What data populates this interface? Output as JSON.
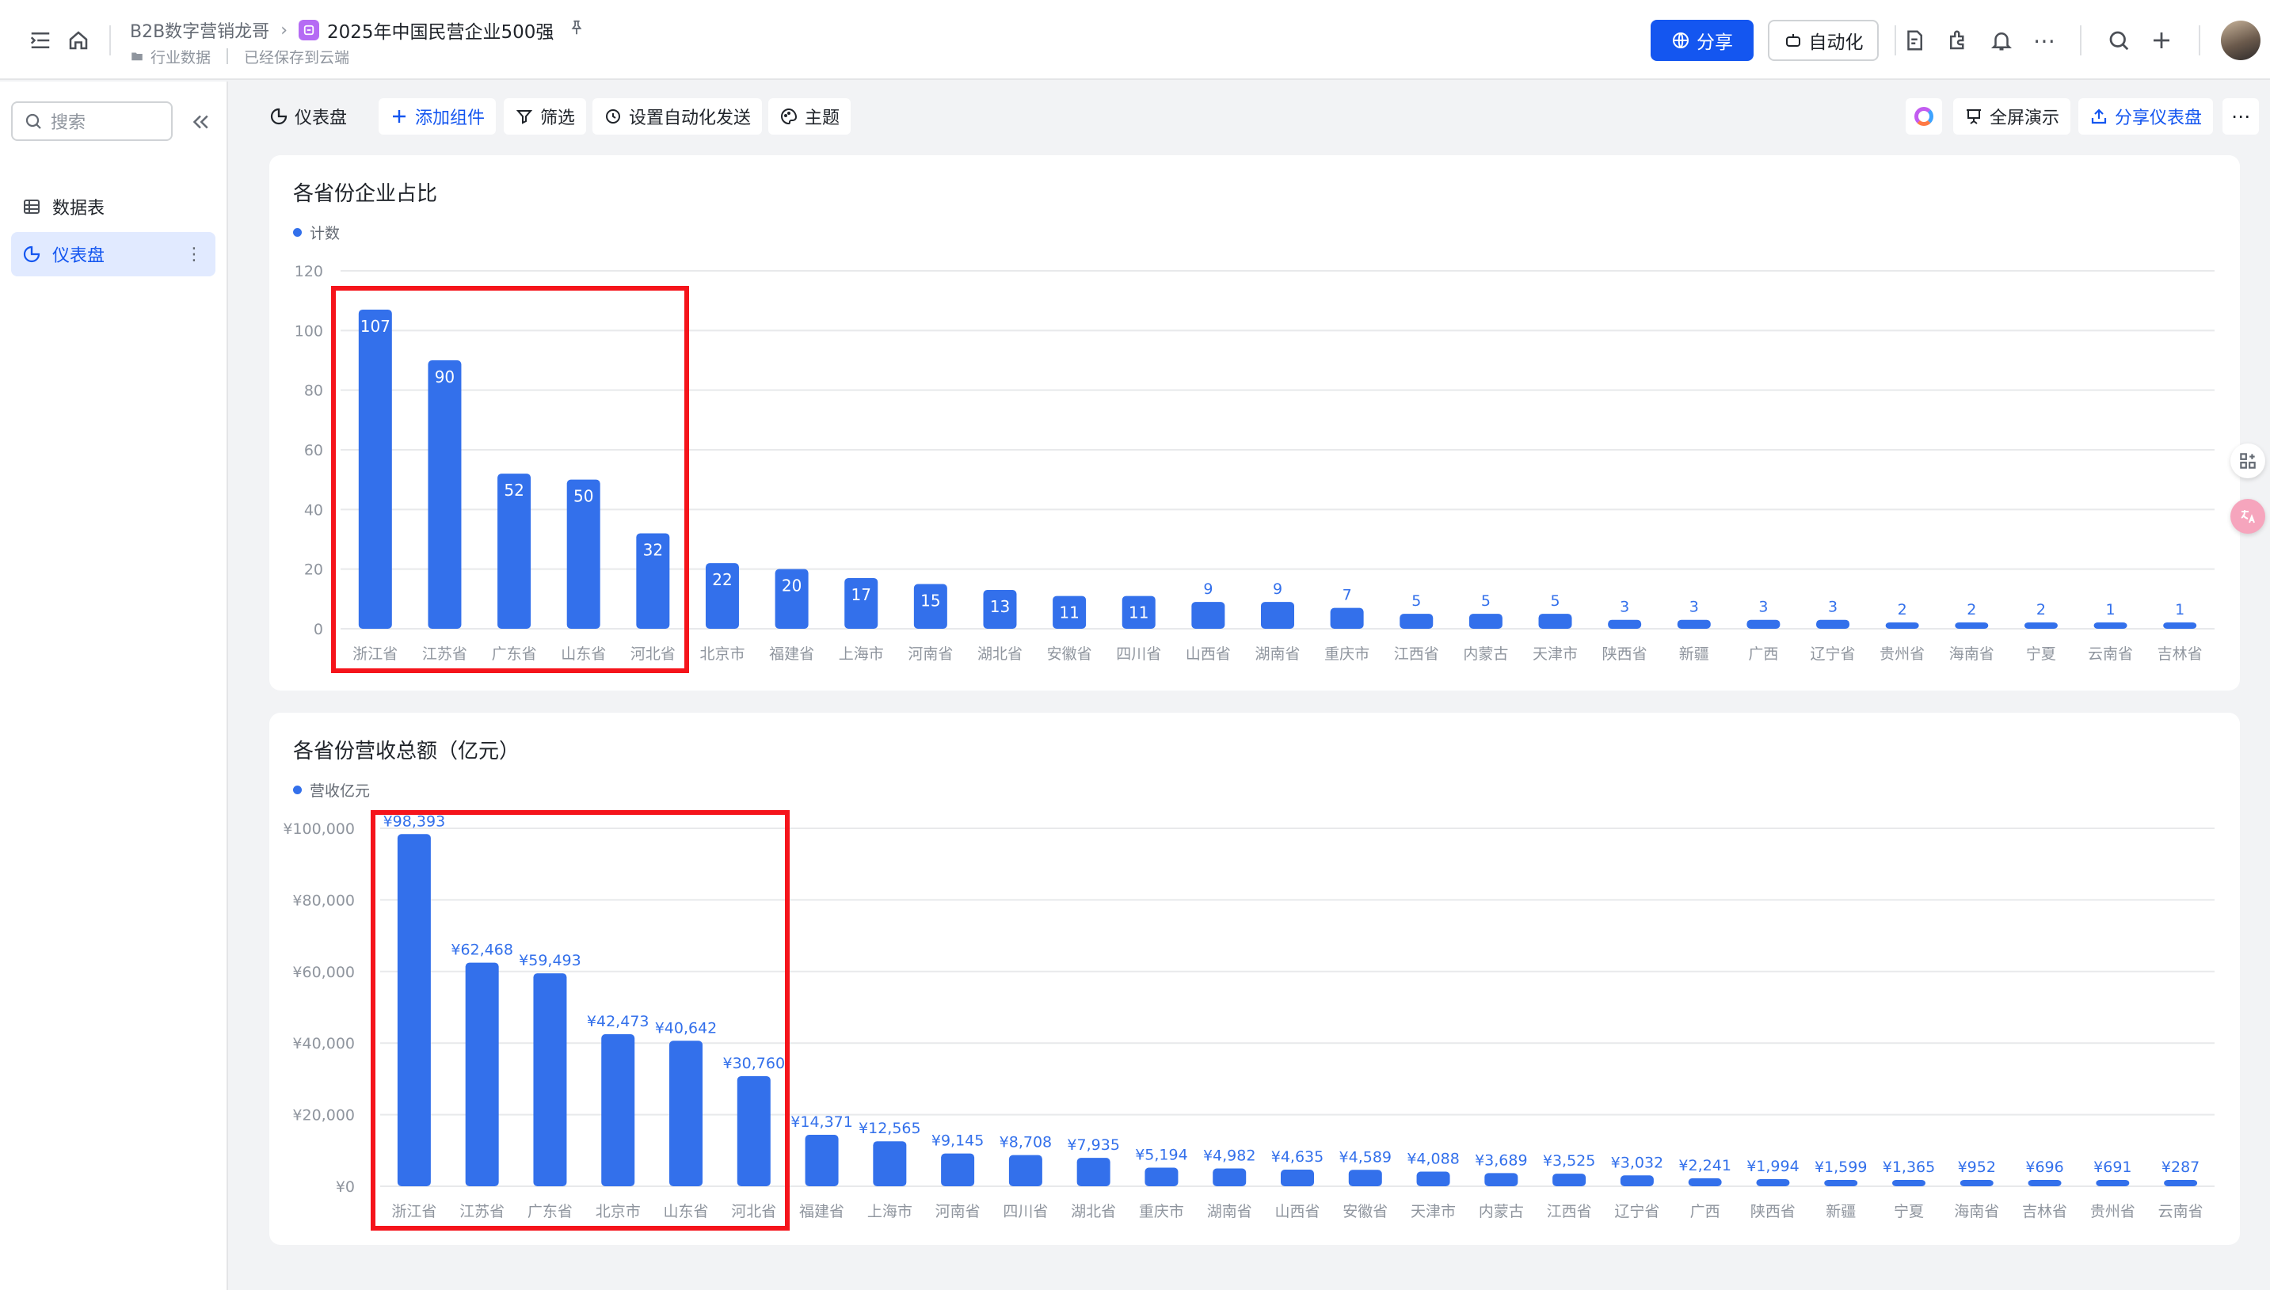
{
  "header": {
    "breadcrumb_parent": "B2B数字营销龙哥",
    "doc_title": "2025年中国民营企业500强",
    "folder": "行业数据",
    "save_status": "已经保存到云端",
    "share_label": "分享",
    "automation_label": "自动化"
  },
  "sidebar": {
    "search_placeholder": "搜索",
    "items": [
      {
        "label": "数据表"
      },
      {
        "label": "仪表盘"
      }
    ]
  },
  "toolbar": {
    "dashboard_label": "仪表盘",
    "add_widget": "添加组件",
    "filter": "筛选",
    "auto_send": "设置自动化发送",
    "theme": "主题",
    "fullscreen": "全屏演示",
    "share_dashboard": "分享仪表盘"
  },
  "colors": {
    "accent": "#1456f0",
    "bar": "#3370eb",
    "highlight": "#f5141b"
  },
  "chart_data": [
    {
      "type": "bar",
      "title": "各省份企业占比",
      "legend": "计数",
      "ylim": [
        0,
        120
      ],
      "yticks": [
        "0",
        "20",
        "40",
        "60",
        "80",
        "100",
        "120"
      ],
      "grid": true,
      "label_position": "inside",
      "categories": [
        "浙江省",
        "江苏省",
        "广东省",
        "山东省",
        "河北省",
        "北京市",
        "福建省",
        "上海市",
        "河南省",
        "湖北省",
        "安徽省",
        "四川省",
        "山西省",
        "湖南省",
        "重庆市",
        "江西省",
        "内蒙古",
        "天津市",
        "陕西省",
        "新疆",
        "广西",
        "辽宁省",
        "贵州省",
        "海南省",
        "宁夏",
        "云南省",
        "吉林省"
      ],
      "values": [
        107,
        90,
        52,
        50,
        32,
        22,
        20,
        17,
        15,
        13,
        11,
        11,
        9,
        9,
        7,
        5,
        5,
        5,
        3,
        3,
        3,
        3,
        2,
        2,
        2,
        1,
        1
      ],
      "data_labels": [
        "107",
        "90",
        "52",
        "50",
        "32",
        "22",
        "20",
        "17",
        "15",
        "13",
        "11",
        "11",
        "9",
        "9",
        "7",
        "5",
        "5",
        "5",
        "3",
        "3",
        "3",
        "3",
        "2",
        "2",
        "2",
        "1",
        "1"
      ],
      "highlight_range": [
        0,
        4
      ]
    },
    {
      "type": "bar",
      "title": "各省份营收总额（亿元）",
      "legend": "营收亿元",
      "ylim": [
        0,
        100000
      ],
      "yticks": [
        "¥0",
        "¥20,000",
        "¥40,000",
        "¥60,000",
        "¥80,000",
        "¥100,000"
      ],
      "grid": true,
      "label_position": "above",
      "categories": [
        "浙江省",
        "江苏省",
        "广东省",
        "北京市",
        "山东省",
        "河北省",
        "福建省",
        "上海市",
        "河南省",
        "四川省",
        "湖北省",
        "重庆市",
        "湖南省",
        "山西省",
        "安徽省",
        "天津市",
        "内蒙古",
        "江西省",
        "辽宁省",
        "广西",
        "陕西省",
        "新疆",
        "宁夏",
        "海南省",
        "吉林省",
        "贵州省",
        "云南省"
      ],
      "values": [
        98393,
        62468,
        59493,
        42473,
        40642,
        30760,
        14371,
        12565,
        9145,
        8708,
        7935,
        5194,
        4982,
        4635,
        4589,
        4088,
        3689,
        3525,
        3032,
        2241,
        1994,
        1599,
        1365,
        952,
        696,
        691,
        287
      ],
      "data_labels": [
        "¥98,393",
        "¥62,468",
        "¥59,493",
        "¥42,473",
        "¥40,642",
        "¥30,760",
        "¥14,371",
        "¥12,565",
        "¥9,145",
        "¥8,708",
        "¥7,935",
        "¥5,194",
        "¥4,982",
        "¥4,635",
        "¥4,589",
        "¥4,088",
        "¥3,689",
        "¥3,525",
        "¥3,032",
        "¥2,241",
        "¥1,994",
        "¥1,599",
        "¥1,365",
        "¥952",
        "¥696",
        "¥691",
        "¥287"
      ],
      "highlight_range": [
        0,
        5
      ]
    }
  ]
}
